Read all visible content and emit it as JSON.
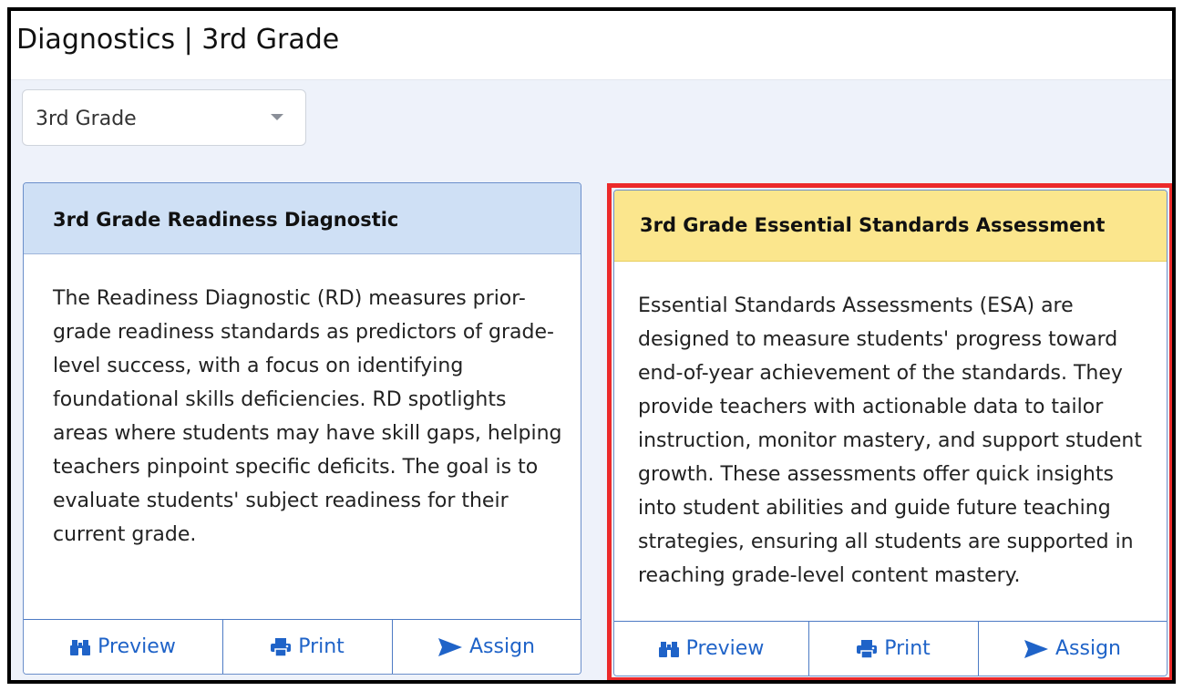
{
  "page": {
    "title": "Diagnostics | 3rd Grade"
  },
  "grade_select": {
    "value": "3rd Grade"
  },
  "cards": [
    {
      "title": "3rd Grade Readiness Diagnostic",
      "description": "The Readiness Diagnostic (RD) measures prior-grade readiness standards as predictors of grade-level success, with a focus on identifying foundational skills deficiencies. RD spotlights areas where students may have skill gaps, helping teachers pinpoint specific deficits. The goal is to evaluate students' subject readiness for their current grade.",
      "header_color": "#cfe0f5",
      "buttons": {
        "preview": "Preview",
        "print": "Print",
        "assign": "Assign"
      }
    },
    {
      "title": "3rd Grade Essential Standards Assessment",
      "description": "Essential Standards Assessments (ESA) are designed to measure students' progress toward end-of-year achievement of the standards. They provide teachers with actionable data to tailor instruction, monitor mastery, and support student growth. These assessments offer quick insights into student abilities and guide future teaching strategies, ensuring all students are supported in reaching grade-level content mastery.",
      "header_color": "#fbe68d",
      "highlight_color": "#ec2a2a",
      "buttons": {
        "preview": "Preview",
        "print": "Print",
        "assign": "Assign"
      }
    }
  ],
  "colors": {
    "accent": "#1f63c8",
    "background": "#eef2fa"
  },
  "icons": {
    "preview": "binoculars-icon",
    "print": "printer-icon",
    "assign": "send-icon"
  }
}
